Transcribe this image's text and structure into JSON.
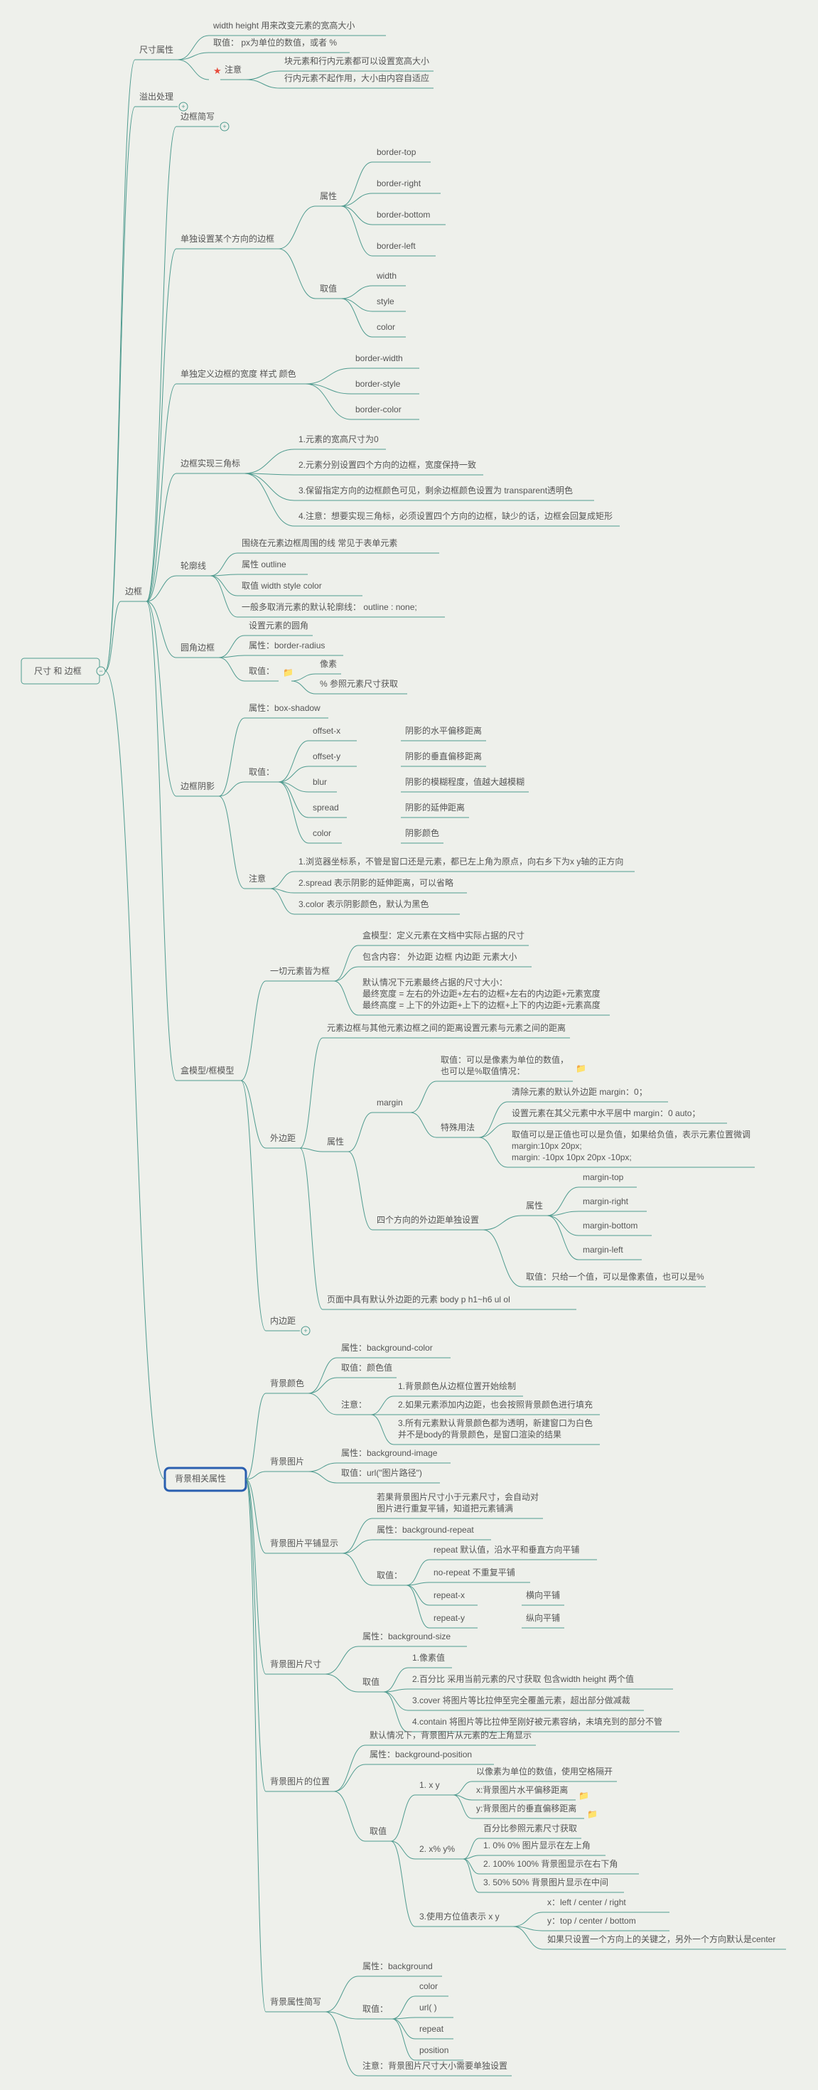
{
  "root": "尺寸 和 边框",
  "size_attr": {
    "title": "尺寸属性",
    "wh": "width height   用来改变元素的宽高大小",
    "value": "取值：  px为单位的数值，或者 %",
    "note_label": "注意",
    "note1": "块元素和行内元素都可以设置宽高大小",
    "note2": "行内元素不起作用，大小由内容自适应"
  },
  "overflow": "溢出处理",
  "border": {
    "title": "边框",
    "shorthand": "边框简写",
    "single_dir": {
      "title": "单独设置某个方向的边框",
      "attr": "属性",
      "val": "取值",
      "items": [
        "border-top",
        "border-right",
        "border-bottom",
        "border-left"
      ],
      "vals": [
        "width",
        "style",
        "color"
      ]
    },
    "single_def": {
      "title": "单独定义边框的宽度 样式 颜色",
      "items": [
        "border-width",
        "border-style",
        "border-color"
      ]
    },
    "triangle": {
      "title": "边框实现三角标",
      "items": [
        "1.元素的宽高尺寸为0",
        "2.元素分别设置四个方向的边框，宽度保持一致",
        "3.保留指定方向的边框颜色可见，剩余边框颜色设置为 transparent透明色",
        "4.注意：想要实现三角标，必须设置四个方向的边框，缺少的话，边框会回复成矩形"
      ]
    },
    "outline": {
      "title": "轮廓线",
      "desc": "围绕在元素边框周围的线        常见于表单元素",
      "attr": "属性  outline",
      "val": "取值  width style  color",
      "tip": "一般多取消元素的默认轮廓线： outline : none;"
    },
    "radius": {
      "title": "圆角边框",
      "desc": "设置元素的圆角",
      "attr": "属性：border-radius",
      "val_label": "取值：",
      "vals": [
        "像素",
        "%  参照元素尺寸获取"
      ]
    },
    "shadow": {
      "title": "边框阴影",
      "attr": "属性：box-shadow",
      "val_label": "取值：",
      "vals": [
        [
          "offset-x",
          "阴影的水平偏移距离"
        ],
        [
          "offset-y",
          "阴影的垂直偏移距离"
        ],
        [
          "blur",
          "阴影的模糊程度，值越大越模糊"
        ],
        [
          "spread",
          "阴影的延伸距离"
        ],
        [
          "color",
          "阴影颜色"
        ]
      ],
      "note_label": "注意",
      "notes": [
        "1.浏览器坐标系，不管是窗口还是元素，都已左上角为原点，向右乡下为x y轴的正方向",
        "2.spread 表示阴影的延伸距离，可以省略",
        "3.color    表示阴影颜色，默认为黑色"
      ]
    },
    "box_model": {
      "title": "盒模型/框模型",
      "all_box": {
        "title": "一切元素皆为框",
        "l1": "盒模型：定义元素在文档中实际占据的尺寸",
        "l2": "包含内容： 外边距 边框 内边距 元素大小",
        "l3": "默认情况下元素最终占据的尺寸大小：\n最终宽度 = 左右的外边距+左右的边框+左右的内边距+元素宽度\n最终高度 = 上下的外边距+上下的边框+上下的内边距+元素高度"
      },
      "margin": {
        "title": "外边距",
        "desc": "元素边框与其他元素边框之间的距离设置元素与元素之间的距离",
        "attr_label": "属性",
        "margin_label": "margin",
        "val": "取值：可以是像素为单位的数值，\n也可以是%取值情况：",
        "special": {
          "title": "特殊用法",
          "items": [
            "清除元素的默认外边距   margin：0；",
            "设置元素在其父元素中水平居中   margin：0 auto；",
            "取值可以是正值也可以是负值，如果给负值，表示元素位置微调\nmargin:10px 20px;\nmargin: -10px 10px 20px -10px;"
          ]
        },
        "four_dir": {
          "title": "四个方向的外边距单独设置",
          "attr": "属性",
          "items": [
            "margin-top",
            "margin-right",
            "margin-bottom",
            "margin-left"
          ],
          "val": "取值：只给一个值，可以是像素值，也可以是%"
        },
        "default": "页面中具有默认外边距的元素         body p h1~h6 ul ol"
      },
      "padding": "内边距"
    }
  },
  "bg": {
    "title": "背景相关属性",
    "color": {
      "title": "背景颜色",
      "attr": "属性：background-color",
      "val": "取值：颜色值",
      "note_label": "注意：",
      "notes": [
        "1.背景颜色从边框位置开始绘制",
        "2.如果元素添加内边距，也会按照背景颜色进行填充",
        "3.所有元素默认背景颜色都为透明，新建窗口为白色\n并不是body的背景颜色，是窗口渲染的结果"
      ]
    },
    "image": {
      "title": "背景图片",
      "attr": "属性：background-image",
      "val": "取值：url(\"图片路径\")"
    },
    "repeat": {
      "title": "背景图片平铺显示",
      "desc": "若果背景图片尺寸小于元素尺寸，会自动对\n图片进行重复平铺，知道把元素铺满",
      "attr": "属性：background-repeat",
      "val_label": "取值：",
      "items": [
        [
          "repeat  默认值，沿水平和垂直方向平铺",
          ""
        ],
        [
          "no-repeat 不重复平铺",
          ""
        ],
        [
          "repeat-x",
          "横向平铺"
        ],
        [
          "repeat-y",
          "纵向平铺"
        ]
      ]
    },
    "size": {
      "title": "背景图片尺寸",
      "attr": "属性：background-size",
      "val_label": "取值",
      "items": [
        "1.像素值",
        "2.百分比  采用当前元素的尺寸获取  包含width height 两个值",
        "3.cover 将图片等比拉伸至完全覆盖元素，超出部分做减裁",
        "4.contain 将图片等比拉伸至刚好被元素容纳，未填充到的部分不管"
      ]
    },
    "position": {
      "title": "背景图片的位置",
      "default": "默认情况下，背景图片从元素的左上角显示",
      "attr": "属性：background-position",
      "val_label": "取值",
      "xy": {
        "title": "1. x y",
        "desc": "以像素为单位的数值，使用空格隔开",
        "x": "x:背景图片水平偏移距离",
        "y": "y:背景图片的垂直偏移距离"
      },
      "pct": {
        "title": "2. x% y%",
        "desc": "百分比参照元素尺寸获取",
        "items": [
          "1. 0% 0%  图片显示在左上角",
          "2. 100%  100%  背景图显示在右下角",
          "3. 50% 50%  背景图片显示在中间"
        ]
      },
      "keyword": {
        "title": "3.使用方位值表示 x y",
        "x": "x：left / center / right",
        "y": "y：top / center / bottom",
        "tip": "如果只设置一个方向上的关键之，另外一个方向默认是center"
      }
    },
    "shorthand": {
      "title": "背景属性简写",
      "attr": "属性：background",
      "val_label": "取值：",
      "items": [
        "color",
        "url( )",
        "repeat",
        "position"
      ],
      "note": "注意：背景图片尺寸大小需要单独设置"
    }
  }
}
